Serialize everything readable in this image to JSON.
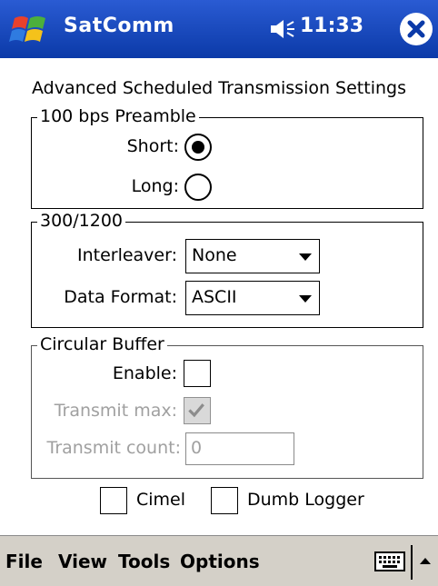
{
  "titlebar": {
    "app_title": "SatComm",
    "clock": "11:33"
  },
  "heading": "Advanced Scheduled Transmission Settings",
  "preamble": {
    "title": "100 bps Preamble",
    "short_label": "Short:",
    "long_label": "Long:",
    "selected": "Short"
  },
  "rates": {
    "title": "300/1200",
    "interleaver_label": "Interleaver:",
    "interleaver_value": "None",
    "data_format_label": "Data Format:",
    "data_format_value": "ASCII"
  },
  "circular_buffer": {
    "title": "Circular Buffer",
    "enable_label": "Enable:",
    "transmit_max_label": "Transmit max:",
    "transmit_count_label": "Transmit count:",
    "transmit_count_value": "0"
  },
  "options": {
    "cimel_label": "Cimel",
    "dumb_logger_label": "Dumb Logger"
  },
  "menubar": {
    "items": [
      "File",
      "View",
      "Tools",
      "Options"
    ]
  },
  "colors": {
    "titlebar": "#0b3aa8",
    "menubar": "#d4d0c8",
    "disabled_text": "#a0a0a0"
  }
}
